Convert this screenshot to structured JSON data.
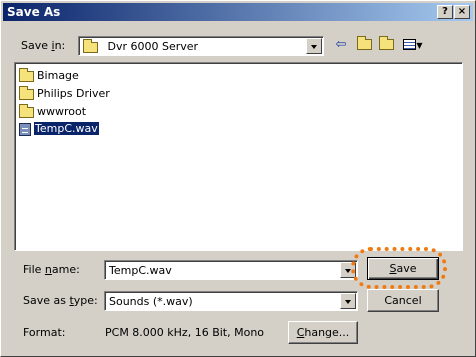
{
  "window": {
    "title": "Save As"
  },
  "titlebar_buttons": {
    "help": "?",
    "close": "×"
  },
  "toolbar": {
    "save_in_label_pre": "Save ",
    "save_in_label_u": "i",
    "save_in_label_post": "n:",
    "location": "Dvr 6000 Server",
    "icons": [
      "back-icon",
      "up-folder-icon",
      "new-folder-icon",
      "views-menu-icon"
    ]
  },
  "files": [
    {
      "name": "Bimage",
      "type": "folder"
    },
    {
      "name": "Philips Driver",
      "type": "folder"
    },
    {
      "name": "wwwroot",
      "type": "folder"
    },
    {
      "name": "TempC.wav",
      "type": "wav",
      "selected": true
    }
  ],
  "filename": {
    "label_pre": "File ",
    "label_u": "n",
    "label_post": "ame:",
    "value": "TempC.wav"
  },
  "savetype": {
    "label_pre": "Save as ",
    "label_u": "t",
    "label_post": "ype:",
    "value": "Sounds (*.wav)"
  },
  "format": {
    "label": "Format:",
    "value": "PCM 8.000 kHz, 16 Bit, Mono"
  },
  "buttons": {
    "save_u": "S",
    "save_rest": "ave",
    "cancel": "Cancel",
    "change_u": "C",
    "change_rest": "hange..."
  },
  "colors": {
    "highlight_ring": "#f07a12",
    "titlebar": "#0a246a"
  }
}
